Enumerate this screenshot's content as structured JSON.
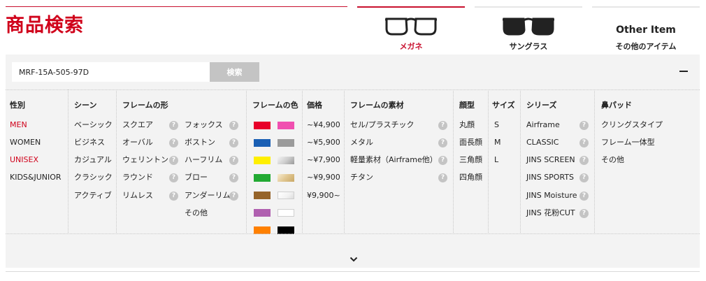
{
  "title": "商品検索",
  "tabs": [
    {
      "id": "glasses",
      "label": "メガネ",
      "active": true
    },
    {
      "id": "sunglasses",
      "label": "サングラス",
      "active": false
    },
    {
      "id": "other",
      "text": "Other Item",
      "label": "その他のアイテム",
      "active": false
    }
  ],
  "search": {
    "value": "MRF-15A-505-97D",
    "button_label": "検索"
  },
  "filters": {
    "gender": {
      "heading": "性別",
      "items": [
        "MEN",
        "WOMEN",
        "UNISEX",
        "KIDS&JUNIOR"
      ]
    },
    "scene": {
      "heading": "シーン",
      "items": [
        "ベーシック",
        "ビジネス",
        "カジュアル",
        "クラシック",
        "アクティブ"
      ]
    },
    "shape": {
      "heading": "フレームの形",
      "items_left": [
        "スクエア",
        "オーバル",
        "ウェリントン",
        "ラウンド",
        "リムレス"
      ],
      "items_right": [
        "フォックス",
        "ボストン",
        "ハーフリム",
        "ブロー",
        "アンダーリム",
        "その他"
      ]
    },
    "color": {
      "heading": "フレームの色"
    },
    "price": {
      "heading": "価格",
      "items": [
        "~¥4,900",
        "~¥5,900",
        "~¥7,900",
        "~¥9,900",
        "¥9,900~"
      ]
    },
    "material": {
      "heading": "フレームの素材",
      "items": [
        "セル/プラスチック",
        "メタル",
        "軽量素材（Airframe他）",
        "チタン"
      ]
    },
    "face": {
      "heading": "顔型",
      "items": [
        "丸顔",
        "面長顔",
        "三角顔",
        "四角顔"
      ]
    },
    "size": {
      "heading": "サイズ",
      "items": [
        "S",
        "M",
        "L"
      ]
    },
    "series": {
      "heading": "シリーズ",
      "items": [
        "Airframe",
        "CLASSIC",
        "JINS SCREEN",
        "JINS SPORTS",
        "JINS Moisture",
        "JINS 花粉CUT"
      ]
    },
    "nosepad": {
      "heading": "鼻パッド",
      "items": [
        "クリングスタイプ",
        "フレーム一体型",
        "その他"
      ]
    }
  },
  "colors": {
    "accent": "#d0021b",
    "swatches": [
      [
        "#e8002a",
        "#f04fb0"
      ],
      [
        "#1a5fb4",
        "#9b9b9b"
      ],
      [
        "#ffef00",
        "gradient-silver"
      ],
      [
        "#22aa33",
        "gradient-gold"
      ],
      [
        "#96642a",
        "gradient-white"
      ],
      [
        "#b060b0",
        "#ffffff"
      ],
      [
        "#ff8000",
        "#000000"
      ]
    ]
  }
}
